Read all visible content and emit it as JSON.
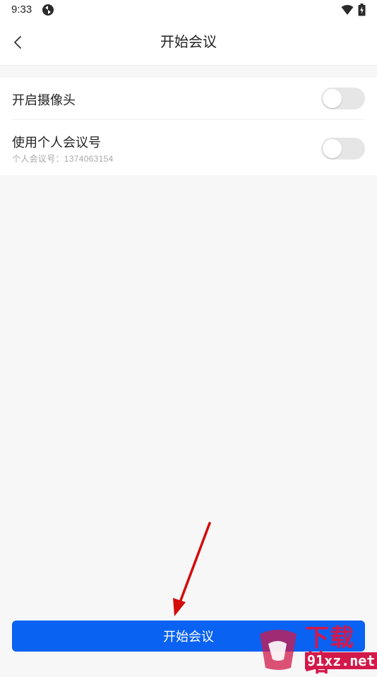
{
  "status_bar": {
    "time": "9:33"
  },
  "header": {
    "title": "开始会议",
    "back_icon": "chevron-left-icon"
  },
  "settings": {
    "camera": {
      "label": "开启摄像头",
      "enabled": false
    },
    "personal_meeting_id": {
      "label": "使用个人会议号",
      "sublabel": "个人会议号：1374063154",
      "enabled": false
    }
  },
  "actions": {
    "start_label": "开始会议"
  },
  "watermark": {
    "text": "下载站",
    "url": "91xz.net"
  },
  "colors": {
    "accent": "#0a62f2",
    "toggle_off": "#e6e6e6",
    "background": "#f7f7f8",
    "annotation_arrow": "#d40b0b",
    "watermark": "#d2194a"
  }
}
